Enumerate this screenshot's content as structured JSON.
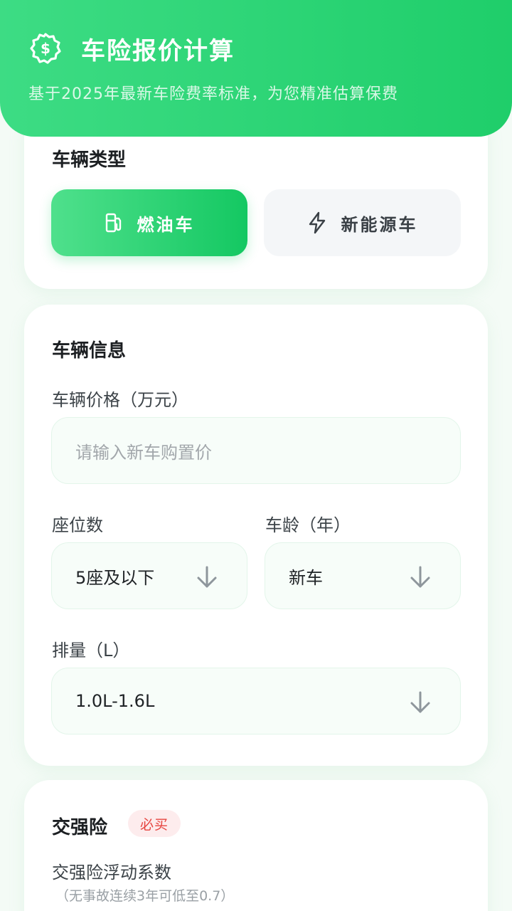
{
  "header": {
    "title": "车险报价计算",
    "subtitle": "基于2025年最新车险费率标准，为您精准估算保费",
    "icon": "dollar-badge-icon"
  },
  "vehicle_type": {
    "title": "车辆类型",
    "options": [
      {
        "label": "燃油车",
        "icon": "fuel-pump-icon",
        "selected": true
      },
      {
        "label": "新能源车",
        "icon": "lightning-icon",
        "selected": false
      }
    ]
  },
  "vehicle_info": {
    "title": "车辆信息",
    "price_label": "车辆价格（万元）",
    "price_placeholder": "请输入新车购置价",
    "seats_label": "座位数",
    "seats_value": "5座及以下",
    "age_label": "车龄（年）",
    "age_value": "新车",
    "displacement_label": "排量（L）",
    "displacement_value": "1.0L-1.6L"
  },
  "compulsory": {
    "title": "交强险",
    "badge": "必买",
    "factor_label": "交强险浮动系数",
    "factor_note": "（无事故连续3年可低至0.7）"
  },
  "colors": {
    "accent": "#1fce6a",
    "badge_text": "#e6443f",
    "badge_bg": "#fdeced"
  }
}
